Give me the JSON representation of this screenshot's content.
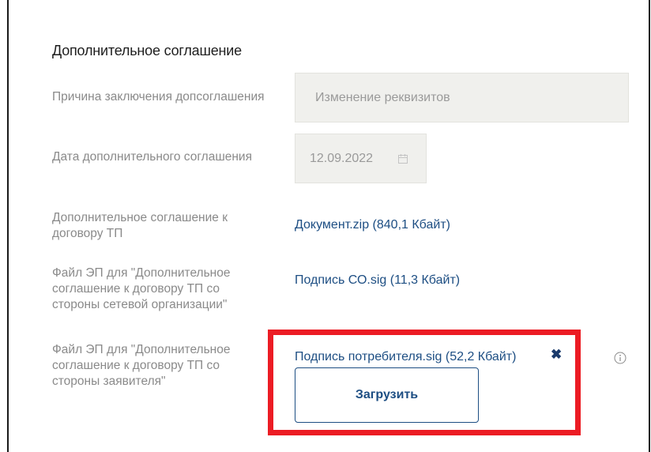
{
  "section": {
    "title": "Дополнительное соглашение"
  },
  "rows": [
    {
      "label": "Причина заключения допсоглашения",
      "value": "Изменение реквизитов"
    },
    {
      "label": "Дата дополнительного соглашения",
      "value": "12.09.2022",
      "icon": "calendar-icon"
    },
    {
      "label": "Дополнительное соглашение к договору ТП",
      "value": "Документ.zip (840,1 Кбайт)"
    },
    {
      "label": "Файл ЭП для \"Дополнительное соглашение к договору ТП со стороны сетевой организации\"",
      "value": "Подпись СО.sig (11,3 Кбайт)"
    },
    {
      "label": "Файл ЭП для \"Дополнительное соглашение к договору ТП со стороны заявителя\"",
      "value": "Подпись потребителя.sig (52,2 Кбайт)",
      "remove_icon": "close-icon",
      "info_icon": "info-icon",
      "upload_label": "Загрузить"
    }
  ],
  "colors": {
    "link": "#1d4e83",
    "label": "#8a8a8a",
    "field_bg": "#f0f0ed",
    "highlight": "#ec1c24"
  }
}
